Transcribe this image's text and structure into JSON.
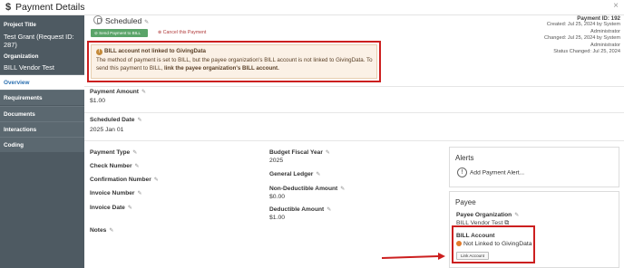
{
  "window": {
    "title": "Payment Details",
    "close_glyph": "×",
    "title_icon": "$"
  },
  "sidebar": {
    "project_title_label": "Project Title",
    "project_title_value": "Test Grant (Request ID: 287)",
    "organization_label": "Organization",
    "organization_value": "BILL Vendor Test",
    "nav": [
      {
        "label": "Overview",
        "active": true
      },
      {
        "label": "Requirements",
        "active": false
      },
      {
        "label": "Documents",
        "active": false
      },
      {
        "label": "Interactions",
        "active": false
      },
      {
        "label": "Coding",
        "active": false
      }
    ]
  },
  "status": {
    "label": "Scheduled",
    "send_button": "Send Payment to BILL",
    "cancel_link": "Cancel this Payment"
  },
  "meta": {
    "payment_id": "Payment ID: 192",
    "created": "Created: Jul 25, 2024 by System Administrator",
    "changed": "Changed: Jul 25, 2024 by System Administrator",
    "status_changed": "Status Changed: Jul 25, 2024"
  },
  "alert": {
    "title": "BILL account not linked to GivingData",
    "body_prefix": "The method of payment is set to BILL, but the payee organization's BILL account is not linked to GivingData. To send this payment to BILL, ",
    "body_bold": "link the payee organization's BILL account.",
    "color": "#cc1f1f"
  },
  "fields": {
    "payment_amount_label": "Payment Amount",
    "payment_amount_value": "$1.00",
    "scheduled_date_label": "Scheduled Date",
    "scheduled_date_value": "2025 Jan 01",
    "payment_type_label": "Payment Type",
    "check_number_label": "Check Number",
    "confirmation_number_label": "Confirmation Number",
    "invoice_number_label": "Invoice Number",
    "invoice_date_label": "Invoice Date",
    "notes_label": "Notes",
    "budget_fiscal_year_label": "Budget Fiscal Year",
    "budget_fiscal_year_value": "2025",
    "general_ledger_label": "General Ledger",
    "non_deductible_label": "Non-Deductible Amount",
    "non_deductible_value": "$0.00",
    "deductible_label": "Deductible Amount",
    "deductible_value": "$1.00"
  },
  "alerts_card": {
    "title": "Alerts",
    "add_label": "Add Payment Alert..."
  },
  "payee_card": {
    "title": "Payee",
    "org_label": "Payee Organization",
    "org_value": "BILL Vendor Test",
    "bill_account_label": "BILL Account",
    "bill_status": "Not Linked to GivingData",
    "link_button": "Link Account"
  },
  "colors": {
    "sidebar_bg": "#4e5a62",
    "active_nav_text": "#2a6fb0",
    "send_button_bg": "#5aa469",
    "status_dot": "#e27a2a"
  }
}
